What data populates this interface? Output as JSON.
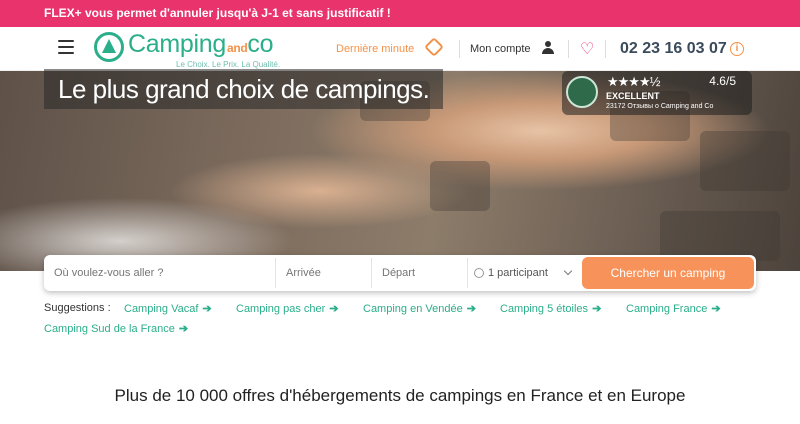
{
  "promo": {
    "text": "FLEX+ vous permet d'annuler jusqu'à J-1 et sans justificatif !"
  },
  "header": {
    "logo": {
      "name": "Camping",
      "small": "and",
      "co": "co",
      "tagline": "Le Choix. Le Prix. La Qualité."
    },
    "last_minute": "Dernière minute",
    "account": "Mon compte",
    "phone": "02 23 16 03 07",
    "info_glyph": "i",
    "icons": [
      "menu-icon",
      "tag-icon",
      "user-icon",
      "heart-icon",
      "info-icon"
    ]
  },
  "hero": {
    "title": "Le plus grand choix de campings."
  },
  "review": {
    "stars": "★★★★½",
    "rating": "4.6/5",
    "label": "EXCELLENT",
    "count": "23172 Отзывы о Camping and Co"
  },
  "search": {
    "destination_placeholder": "Où voulez-vous aller ?",
    "arrival_placeholder": "Arrivée",
    "departure_placeholder": "Départ",
    "participants": "1 participant",
    "button": "Chercher un camping"
  },
  "suggestions": {
    "label": "Suggestions :",
    "items": [
      "Camping Vacaf",
      "Camping pas cher",
      "Camping en Vendée",
      "Camping 5 étoiles",
      "Camping France",
      "Camping Sud de la France"
    ]
  },
  "bottom": {
    "title": "Plus de 10 000 offres d'hébergements de campings en France et en Europe"
  },
  "colors": {
    "promo": "#e8336d",
    "brand": "#2bae8a",
    "accent": "#f7935a",
    "phone": "#3a4b5c"
  }
}
